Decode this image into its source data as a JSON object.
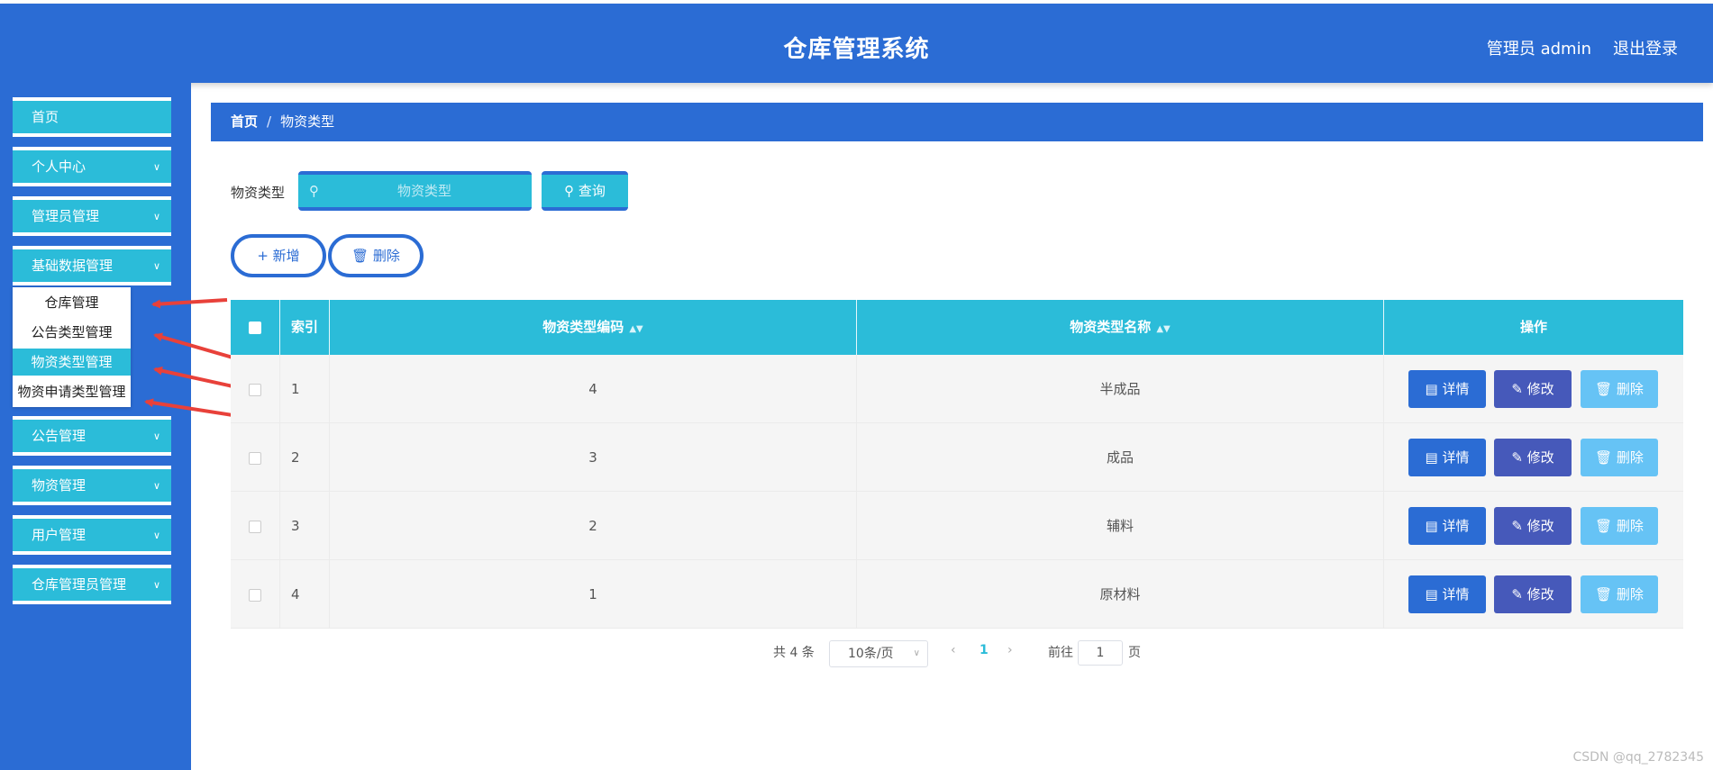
{
  "header": {
    "title": "仓库管理系统",
    "user": "管理员 admin",
    "logout": "退出登录"
  },
  "sidebar": {
    "items": [
      {
        "label": "首页",
        "has_children": false
      },
      {
        "label": "个人中心",
        "has_children": true
      },
      {
        "label": "管理员管理",
        "has_children": true
      },
      {
        "label": "基础数据管理",
        "has_children": true
      },
      {
        "label": "公告管理",
        "has_children": true
      },
      {
        "label": "物资管理",
        "has_children": true
      },
      {
        "label": "用户管理",
        "has_children": true
      },
      {
        "label": "仓库管理员管理",
        "has_children": true
      }
    ],
    "submenu": [
      {
        "label": "仓库管理",
        "active": false
      },
      {
        "label": "公告类型管理",
        "active": false
      },
      {
        "label": "物资类型管理",
        "active": true
      },
      {
        "label": "物资申请类型管理",
        "active": false
      }
    ]
  },
  "breadcrumb": {
    "home": "首页",
    "separator": "/",
    "current": "物资类型"
  },
  "search": {
    "label": "物资类型",
    "placeholder": "物资类型",
    "query_label": "查询",
    "search_icon": "search-icon"
  },
  "actions": {
    "add_label": "新增",
    "delete_label": "删除"
  },
  "table": {
    "columns": [
      {
        "label": "",
        "sortable": false
      },
      {
        "label": "索引",
        "sortable": false
      },
      {
        "label": "物资类型编码",
        "sortable": true
      },
      {
        "label": "物资类型名称",
        "sortable": true
      },
      {
        "label": "操作",
        "sortable": false
      }
    ],
    "rows": [
      {
        "index": "1",
        "code": "4",
        "name": "半成品"
      },
      {
        "index": "2",
        "code": "3",
        "name": "成品"
      },
      {
        "index": "3",
        "code": "2",
        "name": "辅料"
      },
      {
        "index": "4",
        "code": "1",
        "name": "原材料"
      }
    ],
    "op_labels": {
      "detail": "详情",
      "edit": "修改",
      "delete": "删除"
    }
  },
  "pagination": {
    "total": "共 4 条",
    "page_size": "10条/页",
    "current_page": "1",
    "goto_label": "前往",
    "goto_value": "1",
    "page_unit": "页"
  },
  "colors": {
    "primary": "#2b6cd4",
    "accent": "#2bbcd9",
    "edit": "#4659ba",
    "delete": "#66c3f5"
  },
  "watermark": "CSDN @qq_2782345"
}
